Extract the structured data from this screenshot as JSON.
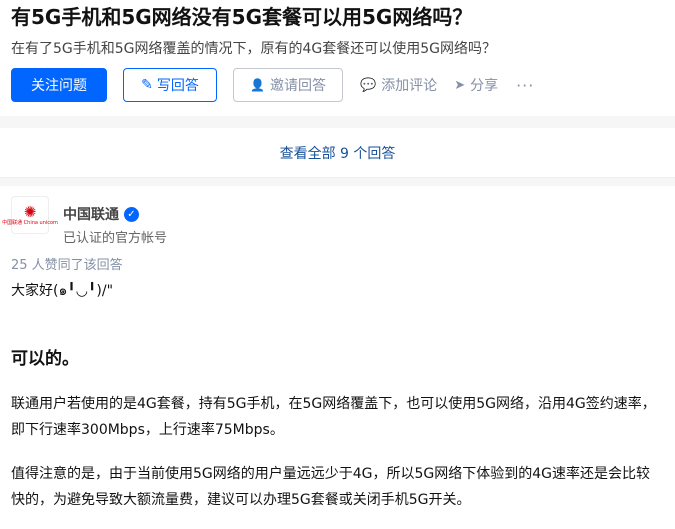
{
  "question": {
    "title": "有5G手机和5G网络没有5G套餐可以用5G网络吗？",
    "detail": "在有了5G手机和5G网络覆盖的情况下，原有的4G套餐还可以使用5G网络吗？"
  },
  "actions": {
    "follow_label": "关注问题",
    "write_label": "写回答",
    "invite_label": "邀请回答",
    "comment_label": "添加评论",
    "share_label": "分享",
    "more_label": "···"
  },
  "answers_bar": {
    "view_all_label": "查看全部 9 个回答"
  },
  "answer": {
    "author": {
      "name": "中国联通",
      "description": "已认证的官方帐号",
      "logo_text": "中国联通 China unicom"
    },
    "upvote_text": "25 人赞同了该回答",
    "greeting": "大家好(๑╹◡╹)/\"",
    "heading": "可以的。",
    "paragraphs": [
      "联通用户若使用的是4G套餐，持有5G手机，在5G网络覆盖下，也可以使用5G网络，沿用4G签约速率，即下行速率300Mbps，上行速率75Mbps。",
      "值得注意的是，由于当前使用5G网络的用户量远远少于4G，所以5G网络下体验到的4G速率还是会比较快的，为避免导致大额流量费，建议可以办理5G套餐或关闭手机5G开关。"
    ]
  },
  "colors": {
    "brand_blue": "#0066ff",
    "link_blue": "#175199",
    "muted": "#8590a6",
    "unicom_red": "#d7000f"
  }
}
